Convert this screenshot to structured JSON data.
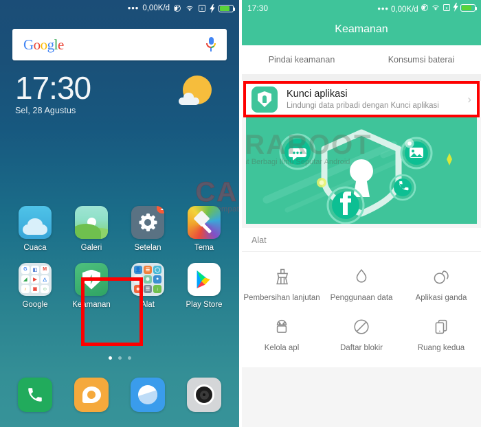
{
  "left_panel": {
    "status_bar": {
      "dots": "•••",
      "network_speed": "0,00K/d",
      "icons": [
        "mute-icon",
        "wifi-icon",
        "no-sim-icon",
        "charging-icon",
        "battery-icon"
      ]
    },
    "search_widget": {
      "logo_letters": [
        "G",
        "o",
        "o",
        "g",
        "l",
        "e"
      ],
      "mic_label": "voice-search"
    },
    "clock_widget": {
      "time": "17:30",
      "date": "Sel, 28 Agustus"
    },
    "watermark": {
      "main": "CARAROOT",
      "sub": "Tempat Berbagi Ilmu Seputar Android"
    },
    "apps": {
      "row1": [
        {
          "label": "Cuaca",
          "icon": "weather-icon",
          "badge": ""
        },
        {
          "label": "Galeri",
          "icon": "gallery-icon",
          "badge": ""
        },
        {
          "label": "Setelan",
          "icon": "settings-gear-icon",
          "badge": "1"
        },
        {
          "label": "Tema",
          "icon": "themes-brush-icon",
          "badge": ""
        }
      ],
      "row2": [
        {
          "label": "Google",
          "icon": "google-folder-icon",
          "badge": ""
        },
        {
          "label": "Keamanan",
          "icon": "security-shield-icon",
          "badge": ""
        },
        {
          "label": "Alat",
          "icon": "tools-folder-icon",
          "badge": ""
        },
        {
          "label": "Play Store",
          "icon": "play-store-icon",
          "badge": ""
        }
      ]
    },
    "page_dots": {
      "count": 3,
      "active": 1
    },
    "dock": [
      {
        "label": "phone",
        "icon": "phone-icon"
      },
      {
        "label": "messages",
        "icon": "message-bubble-icon"
      },
      {
        "label": "browser",
        "icon": "browser-compass-icon"
      },
      {
        "label": "camera",
        "icon": "camera-lens-icon"
      }
    ],
    "highlight": {
      "target": "Keamanan",
      "color": "#fe0000"
    }
  },
  "right_panel": {
    "status_bar": {
      "time": "17:30",
      "dots": "•••",
      "network_speed": "0,00K/d",
      "icons": [
        "mute-icon",
        "wifi-icon",
        "no-sim-icon",
        "charging-icon",
        "battery-icon"
      ]
    },
    "title": "Keamanan",
    "tabs": [
      {
        "label": "Pindai keamanan"
      },
      {
        "label": "Konsumsi baterai"
      }
    ],
    "lock_card": {
      "title": "Kunci aplikasi",
      "subtitle": "Lindungi data pribadi dengan Kunci aplikasi",
      "chevron": "›",
      "icon": "shield-lock-icon",
      "highlight_color": "#fe0000"
    },
    "hero_illustration": {
      "description": "shield-with-keyhole-illustration",
      "app_bubbles": [
        "chat-icon",
        "photo-icon",
        "facebook-icon",
        "phone-icon"
      ],
      "background": "#3fc49a"
    },
    "hero_watermark": {
      "main": "CARAROOT",
      "sub": "Tempat Berbagi Ilmu Seputar Android"
    },
    "tools_section": {
      "header": "Alat",
      "row1": [
        {
          "label": "Pembersihan lanjutan",
          "icon": "broom-icon"
        },
        {
          "label": "Penggunaan data",
          "icon": "water-drop-icon"
        },
        {
          "label": "Aplikasi ganda",
          "icon": "dual-apps-icon"
        }
      ],
      "row2": [
        {
          "label": "Kelola apl",
          "icon": "android-robot-icon"
        },
        {
          "label": "Daftar blokir",
          "icon": "block-circle-icon"
        },
        {
          "label": "Ruang kedua",
          "icon": "second-space-icon"
        }
      ]
    }
  },
  "colors": {
    "accent_green": "#3fc49a",
    "highlight_red": "#fe0000",
    "home_top": "#1b4d77",
    "home_bottom": "#379399"
  }
}
